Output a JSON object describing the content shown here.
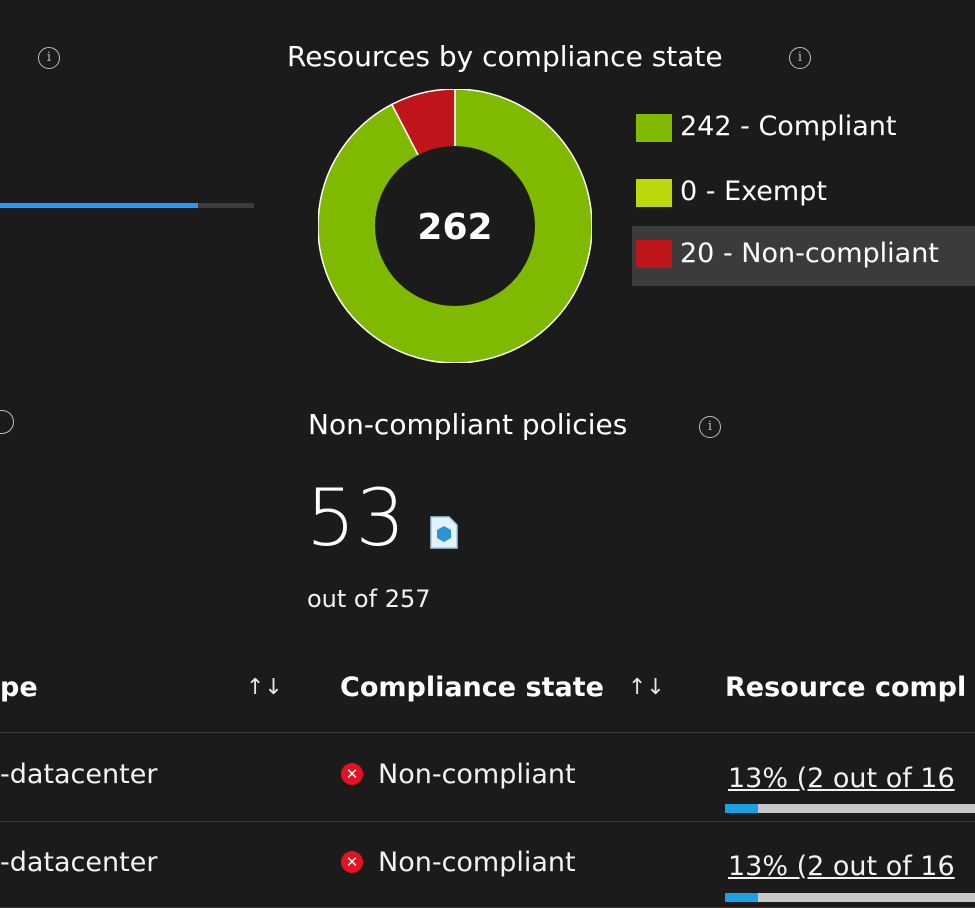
{
  "top_left_card": {
    "progress_fraction": 0.78
  },
  "donut_card": {
    "title": "Resources by compliance state",
    "total": "262",
    "legend": [
      {
        "label": "242 - Compliant",
        "color": "#7fba00"
      },
      {
        "label": "0 - Exempt",
        "color": "#bad80a"
      },
      {
        "label": "20 - Non-compliant",
        "color": "#c0141b"
      }
    ]
  },
  "chart_data": {
    "type": "pie",
    "title": "Resources by compliance state",
    "center_label": "262",
    "categories": [
      "Compliant",
      "Exempt",
      "Non-compliant"
    ],
    "values": [
      242,
      0,
      20
    ],
    "colors": [
      "#7fba00",
      "#bad80a",
      "#c0141b"
    ]
  },
  "policies_card": {
    "title": "Non-compliant policies",
    "count": "53",
    "subtitle": "out of 257"
  },
  "table": {
    "headers": {
      "scope": "pe",
      "compliance_state": "Compliance state",
      "resource_compliance": "Resource compl"
    },
    "sort_glyph": "↑↓",
    "rows": [
      {
        "scope": "-datacenter",
        "state": "Non-compliant",
        "resource": "13% (2 out of 16",
        "fraction": 0.13
      },
      {
        "scope": "-datacenter",
        "state": "Non-compliant",
        "resource": "13% (2 out of 16",
        "fraction": 0.13
      }
    ]
  },
  "icons": {
    "info": "info-icon",
    "policy": "policy-icon",
    "error": "error-icon"
  }
}
